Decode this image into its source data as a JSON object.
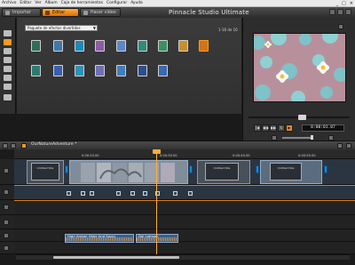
{
  "menu": [
    "Archivo",
    "Editar",
    "Ver",
    "Álbum",
    "Caja de herramientas",
    "Configurar",
    "Ayuda"
  ],
  "window_controls": [
    "_",
    "□",
    "×"
  ],
  "tabs": [
    {
      "label": "Importar",
      "active": false
    },
    {
      "label": "Editar",
      "active": true
    },
    {
      "label": "Hacer vídeo",
      "active": false
    }
  ],
  "app_title": "Pinnacle Studio Ultimate",
  "album": {
    "dropdown_value": "Paquete de efectos divertidos",
    "page_count": "1-16 de 16",
    "thumbnail_count": 16
  },
  "player": {
    "timecode": "0:00:01.07"
  },
  "timeline": {
    "project_name": "OurNatureAdventure *",
    "ruler_ticks": [
      "0:00:20.00",
      "0:00:30.00",
      "0:00:40.00",
      "0:00:50.00"
    ],
    "title_clip_1": "Untitled title",
    "title_clip_2": "Untitled title",
    "title_clip_3": "Untitled title",
    "audio_clip_1": "High Amber (Natr And Save)",
    "audio_clip_2": "Del Lotman"
  },
  "colors": {
    "accent": "#ff9a1c",
    "transition": "#1e86d6",
    "clip": "#586f84"
  }
}
